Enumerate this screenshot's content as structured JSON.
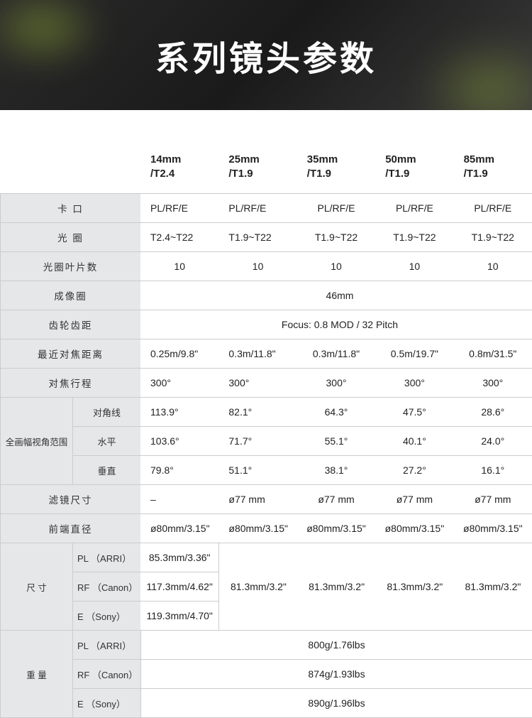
{
  "title": "系列镜头参数",
  "columns": [
    "14mm\n/T2.4",
    "25mm\n/T1.9",
    "35mm\n/T1.9",
    "50mm\n/T1.9",
    "85mm\n/T1.9"
  ],
  "colA": "14mm",
  "colA2": "/T2.4",
  "colB": "25mm",
  "colB2": "/T1.9",
  "colC": "35mm",
  "colC2": "/T1.9",
  "colD": "50mm",
  "colD2": "/T1.9",
  "colE": "85mm",
  "colE2": "/T1.9",
  "labels": {
    "mount": "卡 口",
    "aperture": "光 圈",
    "blades": "光圈叶片数",
    "image_circle": "成像圈",
    "gear_pitch": "齿轮齿距",
    "mfd": "最近对焦距离",
    "focus_throw": "对焦行程",
    "fov": "全画幅视角范围",
    "fov_d": "对角线",
    "fov_h": "水平",
    "fov_v": "垂直",
    "filter": "滤镜尺寸",
    "front": "前端直径",
    "size": "尺 寸",
    "weight": "重 量",
    "pl": "PL （ARRI）",
    "rf": "RF （Canon）",
    "e": "E （Sony）"
  },
  "rows": {
    "mount": [
      "PL/RF/E",
      "PL/RF/E",
      "PL/RF/E",
      "PL/RF/E",
      "PL/RF/E"
    ],
    "aperture": [
      "T2.4~T22",
      "T1.9~T22",
      "T1.9~T22",
      "T1.9~T22",
      "T1.9~T22"
    ],
    "blades": [
      "10",
      "10",
      "10",
      "10",
      "10"
    ],
    "image_circle": "46mm",
    "gear_pitch": "Focus: 0.8 MOD / 32 Pitch",
    "mfd": [
      "0.25m/9.8\"",
      "0.3m/11.8\"",
      "0.3m/11.8\"",
      "0.5m/19.7\"",
      "0.8m/31.5\""
    ],
    "focus_throw": [
      "300°",
      "300°",
      "300°",
      "300°",
      "300°"
    ],
    "fov_d": [
      "113.9°",
      "82.1°",
      "64.3°",
      "47.5°",
      "28.6°"
    ],
    "fov_h": [
      "103.6°",
      "71.7°",
      "55.1°",
      "40.1°",
      "24.0°"
    ],
    "fov_v": [
      "79.8°",
      "51.1°",
      "38.1°",
      "27.2°",
      "16.1°"
    ],
    "filter": [
      "–",
      "ø77 mm",
      "ø77 mm",
      "ø77 mm",
      "ø77 mm"
    ],
    "front": [
      "ø80mm/3.15\"",
      "ø80mm/3.15\"",
      "ø80mm/3.15\"",
      "ø80mm/3.15\"",
      "ø80mm/3.15\""
    ],
    "size_pl": "85.3mm/3.36\"",
    "size_rf": "117.3mm/4.62\"",
    "size_e": "119.3mm/4.70\"",
    "size_rest": "81.3mm/3.2\"",
    "weight_pl": "800g/1.76lbs",
    "weight_rf": "874g/1.93lbs",
    "weight_e": "890g/1.96lbs"
  }
}
